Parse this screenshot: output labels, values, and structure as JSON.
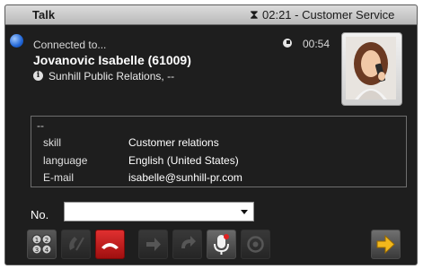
{
  "title": "Talk",
  "title_status": "02:21 - Customer Service",
  "call": {
    "status": "Connected to...",
    "duration": "00:54",
    "caller_name": "Jovanovic Isabelle (61009)",
    "company": "Sunhill Public Relations, --"
  },
  "details": {
    "header": "--",
    "rows": [
      {
        "label": "skill",
        "value": "Customer relations"
      },
      {
        "label": "language",
        "value": "English (United States)"
      },
      {
        "label": "E-mail",
        "value": "isabelle@sunhill-pr.com"
      }
    ]
  },
  "number": {
    "label": "No.",
    "value": ""
  },
  "toolbar": {
    "buttons": [
      {
        "icon": "dialpad-icon",
        "enabled": true
      },
      {
        "icon": "phone-pickup-icon",
        "enabled": false
      },
      {
        "icon": "hang-up-icon",
        "enabled": true
      },
      {
        "icon": "transfer-arrow-icon",
        "enabled": false
      },
      {
        "icon": "forward-icon",
        "enabled": false
      },
      {
        "icon": "microphone-mute-icon",
        "enabled": true
      },
      {
        "icon": "conference-icon",
        "enabled": false
      },
      {
        "icon": "next-arrow-icon",
        "enabled": true
      }
    ]
  },
  "colors": {
    "panel_bg": "#1e1e1e",
    "hangup_red": "#c41a1a",
    "next_arrow_yellow": "#f2b81c",
    "status_blue": "#2166d6"
  }
}
